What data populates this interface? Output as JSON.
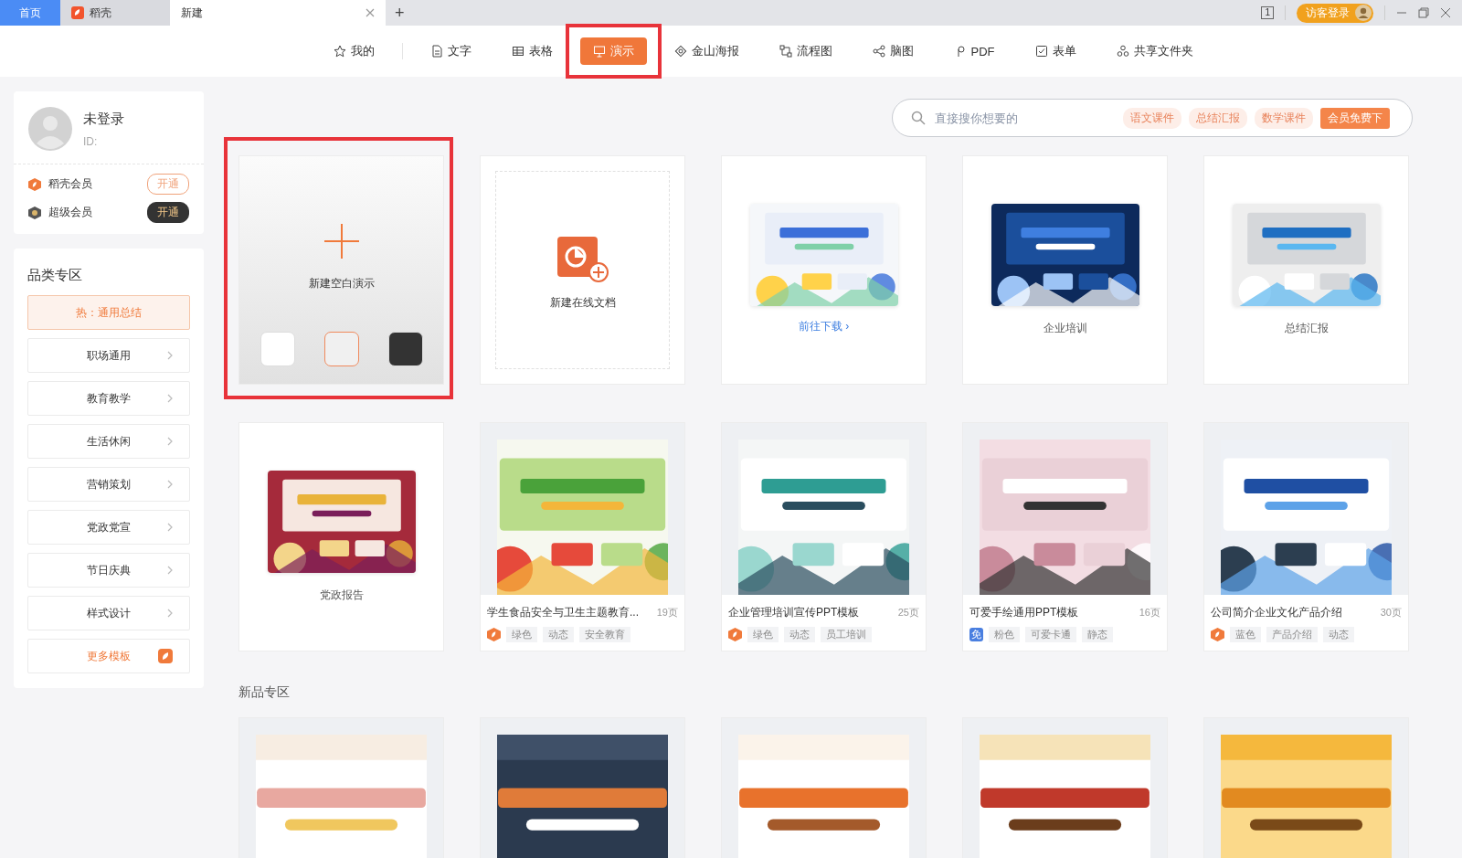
{
  "tabs": [
    {
      "label": "首页",
      "kind": "home",
      "selected": false
    },
    {
      "label": "稻壳",
      "kind": "docer",
      "selected": false
    },
    {
      "label": "新建",
      "kind": "page",
      "selected": true
    }
  ],
  "new_tab": "+",
  "title_bar": {
    "screen_count": "1",
    "login": "访客登录"
  },
  "nav": [
    {
      "label": "我的",
      "kind": "star",
      "selected": false,
      "annotated": false
    },
    {
      "label": "文字",
      "kind": "doc",
      "selected": false,
      "annotated": false
    },
    {
      "label": "表格",
      "kind": "table",
      "selected": false,
      "annotated": false
    },
    {
      "label": "演示",
      "kind": "slides",
      "selected": true,
      "annotated": true
    },
    {
      "label": "金山海报",
      "kind": "poster",
      "selected": false,
      "annotated": false
    },
    {
      "label": "流程图",
      "kind": "flow",
      "selected": false,
      "annotated": false
    },
    {
      "label": "脑图",
      "kind": "mind",
      "selected": false,
      "annotated": false
    },
    {
      "label": "PDF",
      "kind": "pdf",
      "selected": false,
      "annotated": false
    },
    {
      "label": "表单",
      "kind": "form",
      "selected": false,
      "annotated": false
    },
    {
      "label": "共享文件夹",
      "kind": "share",
      "selected": false,
      "annotated": false
    }
  ],
  "profile": {
    "name": "未登录",
    "id": "ID:"
  },
  "memberships": [
    {
      "name": "稻壳会员",
      "kind": "docer",
      "action": "开通"
    },
    {
      "name": "超级会员",
      "kind": "super",
      "action": "开通"
    }
  ],
  "categories": {
    "title": "品类专区",
    "items": [
      {
        "label": "热：通用总结",
        "kind": "hot"
      },
      {
        "label": "职场通用",
        "kind": "link"
      },
      {
        "label": "教育教学",
        "kind": "link"
      },
      {
        "label": "生活休闲",
        "kind": "link"
      },
      {
        "label": "营销策划",
        "kind": "link"
      },
      {
        "label": "党政党宣",
        "kind": "link"
      },
      {
        "label": "节日庆典",
        "kind": "link"
      },
      {
        "label": "样式设计",
        "kind": "link"
      },
      {
        "label": "更多模板",
        "kind": "more"
      }
    ]
  },
  "search": {
    "placeholder": "直接搜你想要的",
    "tags": [
      {
        "label": "语文课件",
        "kind": "tag"
      },
      {
        "label": "总结汇报",
        "kind": "tag"
      },
      {
        "label": "数学课件",
        "kind": "tag"
      },
      {
        "label": "会员免费下",
        "kind": "promo"
      }
    ]
  },
  "cards": [
    {
      "kind": "blank",
      "title": "新建空白演示",
      "annotated": true,
      "swatches": [
        {
          "color": "#ffffff",
          "selected": false
        },
        {
          "color": "#f0f0f0",
          "selected": true
        },
        {
          "color": "#333333",
          "selected": false
        }
      ]
    },
    {
      "kind": "online",
      "title": "新建在线文档",
      "annotated": false
    },
    {
      "kind": "promo",
      "link": "前往下载 ›",
      "annotated": false
    },
    {
      "kind": "category",
      "title": "企业培训",
      "annotated": false
    },
    {
      "kind": "category",
      "title": "总结汇报",
      "annotated": false
    },
    {
      "kind": "category",
      "title": "党政报告",
      "annotated": false
    },
    {
      "kind": "template",
      "title": "学生食品安全与卫生主题教育...",
      "pages": "19页",
      "badge": {
        "kind": "docer"
      },
      "tags": [
        "绿色",
        "动态",
        "安全教育"
      ],
      "annotated": false
    },
    {
      "kind": "template",
      "title": "企业管理培训宣传PPT模板",
      "pages": "25页",
      "badge": {
        "kind": "docer"
      },
      "tags": [
        "绿色",
        "动态",
        "员工培训"
      ],
      "annotated": false
    },
    {
      "kind": "template",
      "title": "可爱手绘通用PPT模板",
      "pages": "16页",
      "badge": {
        "kind": "free",
        "label": "免"
      },
      "tags": [
        "粉色",
        "可爱卡通",
        "静态"
      ],
      "annotated": false
    },
    {
      "kind": "template",
      "title": "公司简介企业文化产品介绍",
      "pages": "30页",
      "badge": {
        "kind": "docer"
      },
      "tags": [
        "蓝色",
        "产品介绍",
        "动态"
      ],
      "annotated": false
    }
  ],
  "new_section": {
    "title": "新品专区"
  }
}
